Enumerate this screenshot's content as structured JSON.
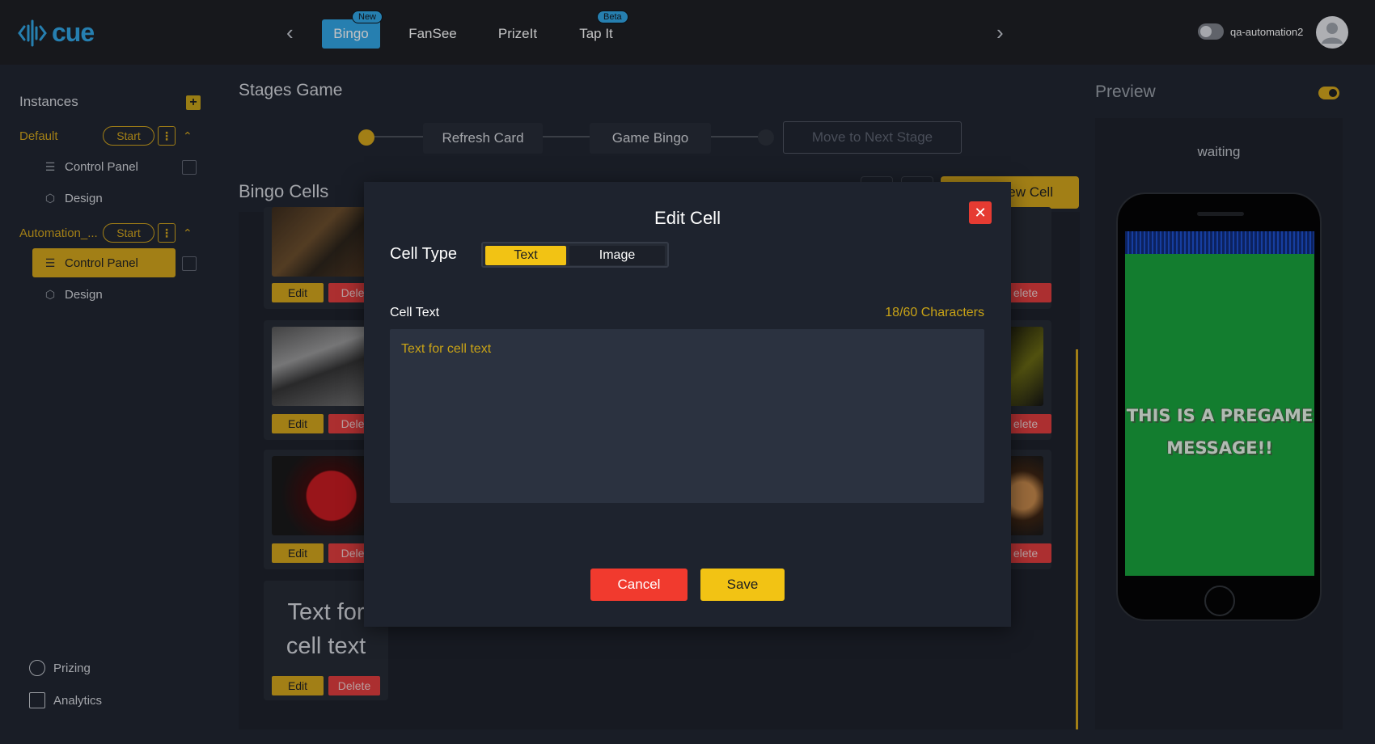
{
  "topbar": {
    "logo_text": "cue",
    "tabs": [
      {
        "label": "Bingo",
        "badge": "New",
        "active": true
      },
      {
        "label": "FanSee"
      },
      {
        "label": "PrizeIt"
      },
      {
        "label": "Tap It",
        "badge": "Beta"
      }
    ],
    "username": "qa-automation2"
  },
  "sidebar": {
    "title": "Instances",
    "instances": [
      {
        "name": "Default",
        "start_label": "Start",
        "items": [
          {
            "label": "Control Panel",
            "icon": "sliders-icon"
          },
          {
            "label": "Design",
            "icon": "cube-icon"
          }
        ]
      },
      {
        "name": "Automation_...",
        "start_label": "Start",
        "items": [
          {
            "label": "Control Panel",
            "icon": "sliders-icon",
            "active": true
          },
          {
            "label": "Design",
            "icon": "cube-icon"
          }
        ]
      }
    ],
    "footer": [
      {
        "label": "Prizing",
        "icon": "award-icon"
      },
      {
        "label": "Analytics",
        "icon": "bar-chart-icon"
      }
    ]
  },
  "main": {
    "stages_title": "Stages Game",
    "stages": [
      "Refresh Card",
      "Game Bingo"
    ],
    "next_stage_label": "Move to Next Stage",
    "bingo_cells_title": "Bingo Cells",
    "new_cell_label": "ew Cell",
    "cards": {
      "edit_label": "Edit",
      "delete_partial": "Delet",
      "delete_full": "Delete",
      "right_delete_partial": "elete",
      "text_card": "Text for cell text"
    }
  },
  "preview": {
    "title": "Preview",
    "status": "waiting",
    "message": "THIS IS A PREGAME MESSAGE!!"
  },
  "modal": {
    "title": "Edit Cell",
    "cell_type_label": "Cell Type",
    "type_options": [
      "Text",
      "Image"
    ],
    "selected_type": "Text",
    "cell_text_label": "Cell Text",
    "char_count": "18/60 Characters",
    "cell_text_value": "Text for cell text",
    "cancel_label": "Cancel",
    "save_label": "Save"
  },
  "colors": {
    "accent_yellow": "#d4a619",
    "accent_blue": "#2fa6e6",
    "danger_red": "#e23b3b",
    "preview_green": "#16a33a"
  }
}
